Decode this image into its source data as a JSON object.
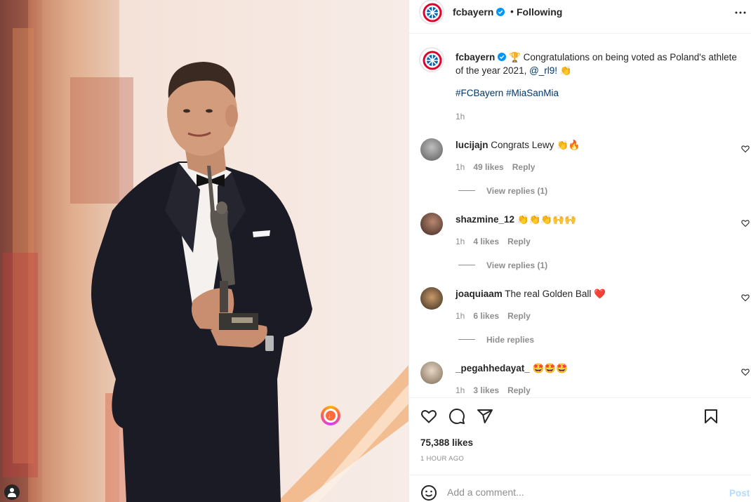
{
  "post": {
    "username": "fcbayern",
    "follow_status": "Following",
    "dot": "•",
    "caption_line": "🏆 Congratulations on being voted as Poland's athlete of the year 2021,",
    "caption_mention": "@_rl9!",
    "caption_emoji": "👏",
    "hashtags": "#FCBayern #MiaSanMia",
    "caption_time": "1h",
    "likes": "75,388 likes",
    "posted_ago": "1 HOUR AGO"
  },
  "comments": [
    {
      "username": "lucijajn",
      "text": "Congrats Lewy",
      "emoji": "👏🔥",
      "time": "1h",
      "likes": "49 likes",
      "reply": "Reply",
      "replies_toggle": "View replies (1)"
    },
    {
      "username": "shazmine_12",
      "text": "",
      "emoji": "👏👏👏🙌🙌",
      "time": "1h",
      "likes": "4 likes",
      "reply": "Reply",
      "replies_toggle": "View replies (1)"
    },
    {
      "username": "joaquiaam",
      "text": "The real Golden Ball",
      "emoji": "❤️",
      "time": "1h",
      "likes": "6 likes",
      "reply": "Reply",
      "replies_toggle": "Hide replies"
    },
    {
      "username": "_pegahhedayat_",
      "text": "",
      "emoji": "🤩🤩🤩",
      "time": "1h",
      "likes": "3 likes",
      "reply": "Reply",
      "replies_toggle": ""
    }
  ],
  "add_comment": {
    "placeholder": "Add a comment...",
    "post_label": "Post"
  },
  "colors": {
    "link": "#00376b",
    "verified": "#0095f6",
    "muted": "#8e8e8e",
    "post_disabled": "#b3dbff",
    "bayern_red": "#dc052d"
  },
  "icons": [
    "more-icon",
    "heart-icon",
    "comment-icon",
    "share-icon",
    "bookmark-icon",
    "smile-icon",
    "verified-icon",
    "user-tag-icon"
  ]
}
